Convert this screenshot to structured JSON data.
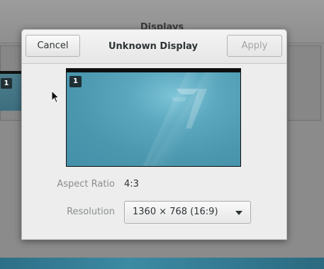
{
  "background_window": {
    "title": "Displays",
    "monitor_badge": "1"
  },
  "dialog": {
    "title": "Unknown Display",
    "cancel_label": "Cancel",
    "apply_label": "Apply",
    "apply_enabled": false,
    "preview": {
      "badge": "1"
    },
    "aspect_ratio": {
      "label": "Aspect Ratio",
      "value": "4:3"
    },
    "resolution": {
      "label": "Resolution",
      "selected": "1360 × 768 (16:9)"
    }
  },
  "icons": {
    "cursor": "mouse-pointer-icon",
    "dropdown": "chevron-down-icon"
  },
  "colors": {
    "dialog_bg": "#ededed",
    "label_gray": "#8b8e8f",
    "text": "#2e3436",
    "desktop_teal": "#4a97ae"
  }
}
